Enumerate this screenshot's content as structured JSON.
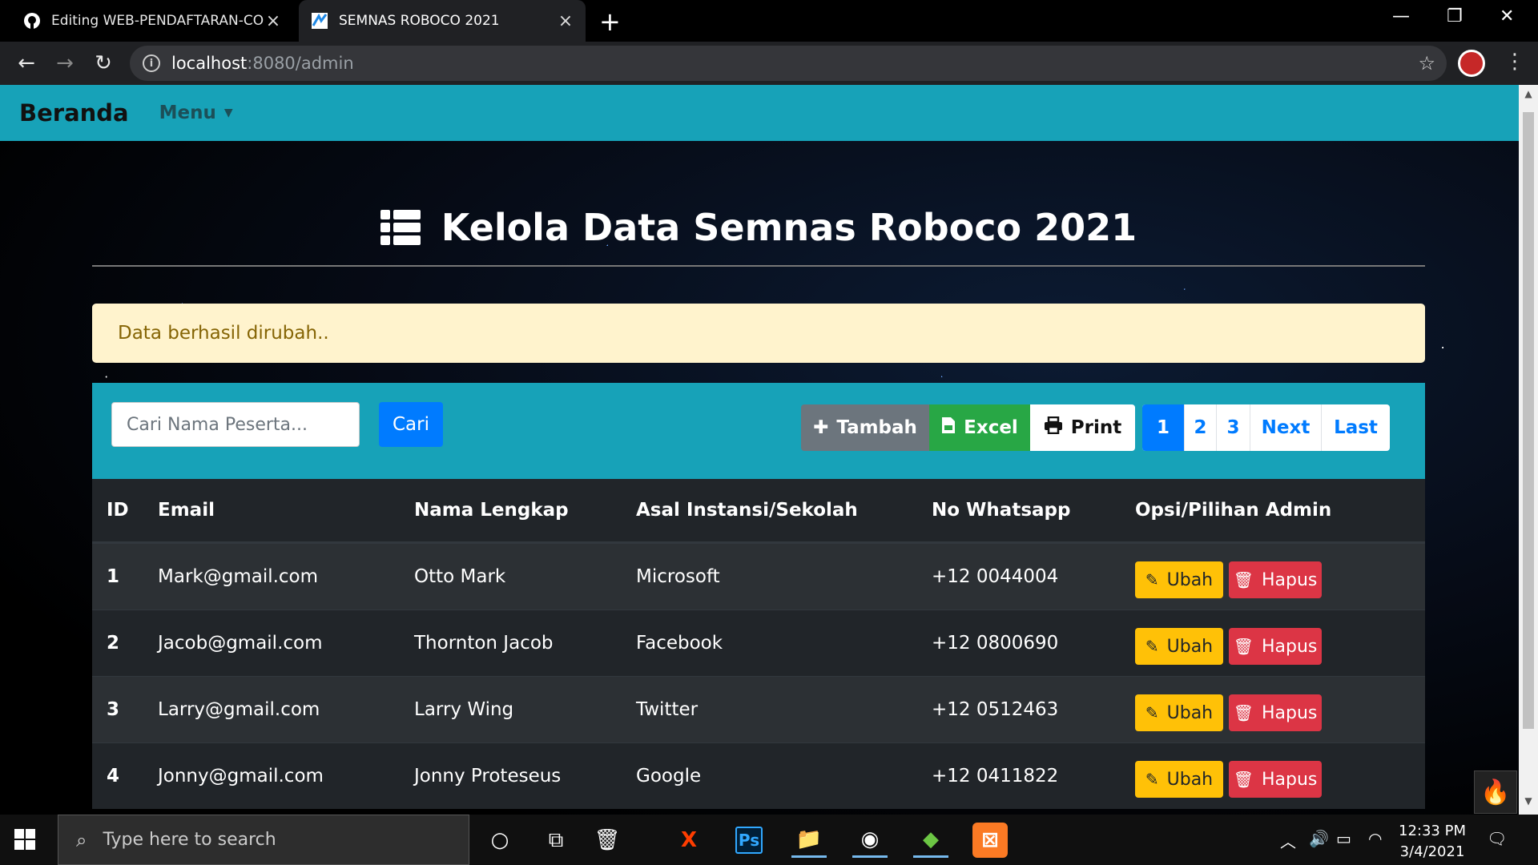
{
  "browser": {
    "tabs": [
      {
        "title": "Editing WEB-PENDAFTARAN-CO",
        "icon": "github-icon"
      },
      {
        "title": "SEMNAS ROBOCO 2021",
        "icon": "site-favicon-icon"
      }
    ],
    "url_host": "localhost",
    "url_path": ":8080/admin"
  },
  "navbar": {
    "brand": "Beranda",
    "menu": "Menu"
  },
  "page": {
    "title": "Kelola Data Semnas Roboco 2021",
    "alert": "Data berhasil dirubah..",
    "search_placeholder": "Cari Nama Peserta...",
    "search_button": "Cari",
    "actions": {
      "tambah": "Tambah",
      "excel": "Excel",
      "print": "Print"
    },
    "pagination": [
      "1",
      "2",
      "3",
      "Next",
      "Last"
    ],
    "active_page": "1"
  },
  "table": {
    "headers": {
      "id": "ID",
      "email": "Email",
      "nama": "Nama Lengkap",
      "asal": "Asal Instansi/Sekolah",
      "wa": "No Whatsapp",
      "opsi": "Opsi/Pilihan Admin"
    },
    "rows": [
      {
        "id": "1",
        "email": "Mark@gmail.com",
        "nama": "Otto Mark",
        "asal": "Microsoft",
        "wa": "+12 0044004"
      },
      {
        "id": "2",
        "email": "Jacob@gmail.com",
        "nama": "Thornton Jacob",
        "asal": "Facebook",
        "wa": "+12 0800690"
      },
      {
        "id": "3",
        "email": "Larry@gmail.com",
        "nama": "Larry Wing",
        "asal": "Twitter",
        "wa": "+12 0512463"
      },
      {
        "id": "4",
        "email": "Jonny@gmail.com",
        "nama": "Jonny Proteseus",
        "asal": "Google",
        "wa": "+12 0411822"
      }
    ],
    "edit_label": "Ubah",
    "delete_label": "Hapus"
  },
  "taskbar": {
    "search_placeholder": "Type here to search",
    "time": "12:33 PM",
    "date": "3/4/2021"
  },
  "colors": {
    "navbar": "#17a2b8",
    "primary": "#007bff",
    "success": "#28a745",
    "warning": "#ffc107",
    "danger": "#dc3545",
    "alert_bg": "#fff3cd"
  }
}
